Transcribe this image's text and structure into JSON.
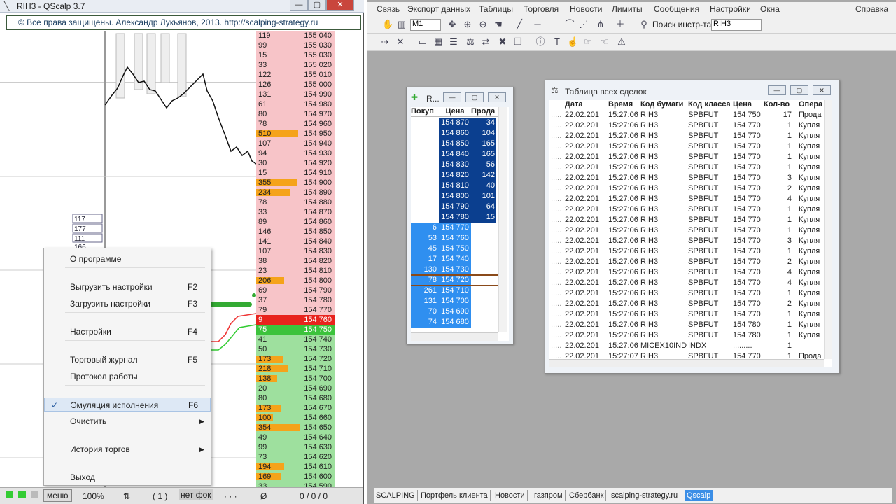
{
  "qscalp": {
    "title": "RIH3 - QScalp 3.7",
    "banner": "© Все права защищены. Александр Лукьянов, 2013. http://scalping-strategy.ru",
    "mini_values": [
      "117",
      "177",
      "111",
      "166"
    ],
    "book": [
      {
        "v": "119",
        "p": "155 040",
        "s": "ask",
        "w": 0
      },
      {
        "v": "99",
        "p": "155 030",
        "s": "ask",
        "w": 0
      },
      {
        "v": "15",
        "p": "155 030",
        "s": "ask",
        "w": 0
      },
      {
        "v": "33",
        "p": "155 020",
        "s": "ask",
        "w": 0
      },
      {
        "v": "122",
        "p": "155 010",
        "s": "ask",
        "w": 0
      },
      {
        "v": "126",
        "p": "155 000",
        "s": "ask",
        "w": 0
      },
      {
        "v": "131",
        "p": "154 990",
        "s": "ask",
        "w": 0
      },
      {
        "v": "61",
        "p": "154 980",
        "s": "ask",
        "w": 0
      },
      {
        "v": "80",
        "p": "154 970",
        "s": "ask",
        "w": 0
      },
      {
        "v": "78",
        "p": "154 960",
        "s": "ask",
        "w": 0
      },
      {
        "v": "510",
        "p": "154 950",
        "s": "ask",
        "w": 60
      },
      {
        "v": "107",
        "p": "154 940",
        "s": "ask",
        "w": 0
      },
      {
        "v": "94",
        "p": "154 930",
        "s": "ask",
        "w": 0
      },
      {
        "v": "30",
        "p": "154 920",
        "s": "ask",
        "w": 0
      },
      {
        "v": "15",
        "p": "154 910",
        "s": "ask",
        "w": 0
      },
      {
        "v": "355",
        "p": "154 900",
        "s": "ask",
        "w": 58
      },
      {
        "v": "234",
        "p": "154 890",
        "s": "ask",
        "w": 48
      },
      {
        "v": "78",
        "p": "154 880",
        "s": "ask",
        "w": 0
      },
      {
        "v": "33",
        "p": "154 870",
        "s": "ask",
        "w": 0
      },
      {
        "v": "89",
        "p": "154 860",
        "s": "ask",
        "w": 0
      },
      {
        "v": "146",
        "p": "154 850",
        "s": "ask",
        "w": 0
      },
      {
        "v": "141",
        "p": "154 840",
        "s": "ask",
        "w": 0
      },
      {
        "v": "107",
        "p": "154 830",
        "s": "ask",
        "w": 0
      },
      {
        "v": "38",
        "p": "154 820",
        "s": "ask",
        "w": 0
      },
      {
        "v": "23",
        "p": "154 810",
        "s": "ask",
        "w": 0
      },
      {
        "v": "206",
        "p": "154 800",
        "s": "ask",
        "w": 40
      },
      {
        "v": "69",
        "p": "154 790",
        "s": "ask",
        "w": 0
      },
      {
        "v": "37",
        "p": "154 780",
        "s": "ask",
        "w": 0
      },
      {
        "v": "79",
        "p": "154 770",
        "s": "ask",
        "w": 0
      },
      {
        "v": "9",
        "p": "154 760",
        "s": "bestask",
        "w": 0
      },
      {
        "v": "75",
        "p": "154 750",
        "s": "bestbid",
        "w": 0
      },
      {
        "v": "41",
        "p": "154 740",
        "s": "bid",
        "w": 0
      },
      {
        "v": "50",
        "p": "154 730",
        "s": "bid",
        "w": 0
      },
      {
        "v": "173",
        "p": "154 720",
        "s": "bid",
        "w": 38
      },
      {
        "v": "218",
        "p": "154 710",
        "s": "bid",
        "w": 46
      },
      {
        "v": "138",
        "p": "154 700",
        "s": "bid",
        "w": 30
      },
      {
        "v": "20",
        "p": "154 690",
        "s": "bid",
        "w": 0
      },
      {
        "v": "80",
        "p": "154 680",
        "s": "bid",
        "w": 0
      },
      {
        "v": "173",
        "p": "154 670",
        "s": "bid",
        "w": 36
      },
      {
        "v": "100",
        "p": "154 660",
        "s": "bid",
        "w": 24
      },
      {
        "v": "354",
        "p": "154 650",
        "s": "bid",
        "w": 62
      },
      {
        "v": "49",
        "p": "154 640",
        "s": "bid",
        "w": 0
      },
      {
        "v": "99",
        "p": "154 630",
        "s": "bid",
        "w": 0
      },
      {
        "v": "73",
        "p": "154 620",
        "s": "bid",
        "w": 0
      },
      {
        "v": "194",
        "p": "154 610",
        "s": "bid",
        "w": 40
      },
      {
        "v": "169",
        "p": "154 600",
        "s": "bid",
        "w": 36
      },
      {
        "v": "33",
        "p": "154 590",
        "s": "bid",
        "w": 0
      }
    ],
    "menu": [
      {
        "label": "О программе",
        "key": "",
        "sep_after": true
      },
      {
        "label": "Выгрузить настройки",
        "key": "F2"
      },
      {
        "label": "Загрузить настройки",
        "key": "F3",
        "sep_after": true
      },
      {
        "label": "Настройки",
        "key": "F4",
        "sep_after": true
      },
      {
        "label": "Торговый журнал",
        "key": "F5"
      },
      {
        "label": "Протокол работы",
        "key": "",
        "sep_after": true
      },
      {
        "label": "Эмуляция исполнения",
        "key": "F6",
        "checked": true,
        "highlight": true
      },
      {
        "label": "Очистить",
        "key": "",
        "submenu": true,
        "sep_after": true
      },
      {
        "label": "История торгов",
        "key": "",
        "submenu": true,
        "sep_after": true
      },
      {
        "label": "Выход",
        "key": ""
      }
    ],
    "status": {
      "menu": "меню",
      "zoom": "100%",
      "arrows": "⇅",
      "position": "( 1 )",
      "focus": "нет фок",
      "dots": "· · ·",
      "zero": "Ø",
      "counts": "0 / 0 / 0"
    }
  },
  "quik": {
    "menus": [
      "Связь",
      "Экспорт данных",
      "Таблицы",
      "Торговля",
      "Новости",
      "Лимиты",
      "Сообщения",
      "Настройки",
      "Окна",
      "Справка"
    ],
    "timeframe": "M1",
    "search_label": "Поиск инстр-та",
    "search_value": "RIH3",
    "orderbook": {
      "title": "R...",
      "headers": [
        "Покуп",
        "Цена",
        "Прода"
      ],
      "rows": [
        {
          "b": "",
          "p": "154 870",
          "s": "34"
        },
        {
          "b": "",
          "p": "154 860",
          "s": "104"
        },
        {
          "b": "",
          "p": "154 850",
          "s": "165"
        },
        {
          "b": "",
          "p": "154 840",
          "s": "165"
        },
        {
          "b": "",
          "p": "154 830",
          "s": "56"
        },
        {
          "b": "",
          "p": "154 820",
          "s": "142"
        },
        {
          "b": "",
          "p": "154 810",
          "s": "40"
        },
        {
          "b": "",
          "p": "154 800",
          "s": "101"
        },
        {
          "b": "",
          "p": "154 790",
          "s": "64"
        },
        {
          "b": "",
          "p": "154 780",
          "s": "15"
        },
        {
          "b": "6",
          "p": "154 770",
          "s": ""
        },
        {
          "b": "53",
          "p": "154 760",
          "s": ""
        },
        {
          "b": "45",
          "p": "154 750",
          "s": ""
        },
        {
          "b": "17",
          "p": "154 740",
          "s": ""
        },
        {
          "b": "130",
          "p": "154 730",
          "s": ""
        },
        {
          "b": "78",
          "p": "154 720",
          "s": ""
        },
        {
          "b": "261",
          "p": "154 710",
          "s": ""
        },
        {
          "b": "131",
          "p": "154 700",
          "s": ""
        },
        {
          "b": "70",
          "p": "154 690",
          "s": ""
        },
        {
          "b": "74",
          "p": "154 680",
          "s": ""
        }
      ]
    },
    "trades": {
      "title": "Таблица всех сделок",
      "headers": [
        "Дата",
        "Время",
        "Код бумаги",
        "Код класса",
        "Цена",
        "Кол-во",
        "Опера"
      ],
      "rows": [
        [
          "22.02.201",
          "15:27:06",
          "RIH3",
          "SPBFUT",
          "154 750",
          "17",
          "Прода"
        ],
        [
          "22.02.201",
          "15:27:06",
          "RIH3",
          "SPBFUT",
          "154 770",
          "1",
          "Купля"
        ],
        [
          "22.02.201",
          "15:27:06",
          "RIH3",
          "SPBFUT",
          "154 770",
          "1",
          "Купля"
        ],
        [
          "22.02.201",
          "15:27:06",
          "RIH3",
          "SPBFUT",
          "154 770",
          "1",
          "Купля"
        ],
        [
          "22.02.201",
          "15:27:06",
          "RIH3",
          "SPBFUT",
          "154 770",
          "1",
          "Купля"
        ],
        [
          "22.02.201",
          "15:27:06",
          "RIH3",
          "SPBFUT",
          "154 770",
          "1",
          "Купля"
        ],
        [
          "22.02.201",
          "15:27:06",
          "RIH3",
          "SPBFUT",
          "154 770",
          "3",
          "Купля"
        ],
        [
          "22.02.201",
          "15:27:06",
          "RIH3",
          "SPBFUT",
          "154 770",
          "2",
          "Купля"
        ],
        [
          "22.02.201",
          "15:27:06",
          "RIH3",
          "SPBFUT",
          "154 770",
          "4",
          "Купля"
        ],
        [
          "22.02.201",
          "15:27:06",
          "RIH3",
          "SPBFUT",
          "154 770",
          "1",
          "Купля"
        ],
        [
          "22.02.201",
          "15:27:06",
          "RIH3",
          "SPBFUT",
          "154 770",
          "1",
          "Купля"
        ],
        [
          "22.02.201",
          "15:27:06",
          "RIH3",
          "SPBFUT",
          "154 770",
          "1",
          "Купля"
        ],
        [
          "22.02.201",
          "15:27:06",
          "RIH3",
          "SPBFUT",
          "154 770",
          "3",
          "Купля"
        ],
        [
          "22.02.201",
          "15:27:06",
          "RIH3",
          "SPBFUT",
          "154 770",
          "1",
          "Купля"
        ],
        [
          "22.02.201",
          "15:27:06",
          "RIH3",
          "SPBFUT",
          "154 770",
          "2",
          "Купля"
        ],
        [
          "22.02.201",
          "15:27:06",
          "RIH3",
          "SPBFUT",
          "154 770",
          "4",
          "Купля"
        ],
        [
          "22.02.201",
          "15:27:06",
          "RIH3",
          "SPBFUT",
          "154 770",
          "4",
          "Купля"
        ],
        [
          "22.02.201",
          "15:27:06",
          "RIH3",
          "SPBFUT",
          "154 770",
          "1",
          "Купля"
        ],
        [
          "22.02.201",
          "15:27:06",
          "RIH3",
          "SPBFUT",
          "154 770",
          "2",
          "Купля"
        ],
        [
          "22.02.201",
          "15:27:06",
          "RIH3",
          "SPBFUT",
          "154 770",
          "1",
          "Купля"
        ],
        [
          "22.02.201",
          "15:27:06",
          "RIH3",
          "SPBFUT",
          "154 780",
          "1",
          "Купля"
        ],
        [
          "22.02.201",
          "15:27:06",
          "RIH3",
          "SPBFUT",
          "154 780",
          "1",
          "Купля"
        ],
        [
          "22.02.201",
          "15:27:06",
          "MICEX10INDI",
          "INDX",
          ".........",
          "1",
          ""
        ],
        [
          "22.02.201",
          "15:27:07",
          "RIH3",
          "SPBFUT",
          "154 770",
          "1",
          "Прода"
        ]
      ]
    },
    "tabs": [
      {
        "label": "SCALPING",
        "active": false
      },
      {
        "label": "Портфель клиента",
        "active": false
      },
      {
        "label": "Новости",
        "active": false
      },
      {
        "label": "газпром",
        "active": false
      },
      {
        "label": "Сбербанк",
        "active": false
      },
      {
        "label": "scalping-strategy.ru",
        "active": false
      },
      {
        "label": "Qscalp",
        "active": true
      }
    ]
  }
}
